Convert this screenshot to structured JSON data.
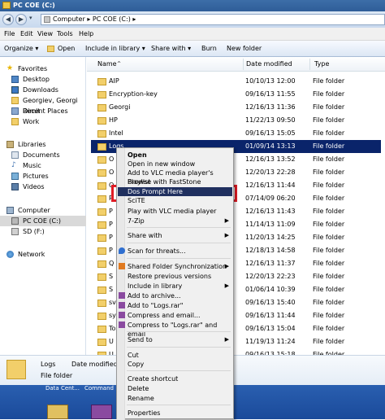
{
  "window": {
    "title": "PC COE (C:)"
  },
  "address": {
    "path": "Computer ▸ PC COE (C:) ▸"
  },
  "menubar": [
    "File",
    "Edit",
    "View",
    "Tools",
    "Help"
  ],
  "toolbar": [
    "Organize ▾",
    "Open",
    "Include in library ▾",
    "Share with ▾",
    "Burn",
    "New folder"
  ],
  "nav": {
    "favorites": {
      "header": "Favorites",
      "items": [
        "Desktop",
        "Downloads",
        "Georgiev, Georgi Dimit",
        "Recent Places",
        "Work"
      ]
    },
    "libraries": {
      "header": "Libraries",
      "items": [
        "Documents",
        "Music",
        "Pictures",
        "Videos"
      ]
    },
    "computer": {
      "header": "Computer",
      "items": [
        "PC COE (C:)",
        "SD (F:)"
      ]
    },
    "network": "Network"
  },
  "columns": {
    "name": "Name",
    "date": "Date modified",
    "type": "Type"
  },
  "files": [
    {
      "name": "AIP",
      "date": "10/10/13 12:00",
      "type": "File folder"
    },
    {
      "name": "Encryption-key",
      "date": "09/16/13 11:55",
      "type": "File folder"
    },
    {
      "name": "Georgi",
      "date": "12/16/13 11:36",
      "type": "File folder"
    },
    {
      "name": "HP",
      "date": "11/22/13 09:50",
      "type": "File folder"
    },
    {
      "name": "Intel",
      "date": "09/16/13 15:05",
      "type": "File folder"
    },
    {
      "name": "Logs",
      "date": "01/09/14 13:13",
      "type": "File folder"
    },
    {
      "name": "O",
      "date": "12/16/13 13:52",
      "type": "File folder"
    },
    {
      "name": "O",
      "date": "12/20/13 22:28",
      "type": "File folder"
    },
    {
      "name": "O",
      "date": "12/16/13 11:44",
      "type": "File folder"
    },
    {
      "name": "P",
      "date": "07/14/09 06:20",
      "type": "File folder"
    },
    {
      "name": "P",
      "date": "12/16/13 11:43",
      "type": "File folder"
    },
    {
      "name": "P",
      "date": "11/14/13 11:09",
      "type": "File folder"
    },
    {
      "name": "P",
      "date": "11/20/13 14:25",
      "type": "File folder"
    },
    {
      "name": "P",
      "date": "12/18/13 14:58",
      "type": "File folder"
    },
    {
      "name": "Q",
      "date": "12/16/13 11:37",
      "type": "File folder"
    },
    {
      "name": "S",
      "date": "12/20/13 22:23",
      "type": "File folder"
    },
    {
      "name": "S",
      "date": "01/06/14 10:39",
      "type": "File folder"
    },
    {
      "name": "sv",
      "date": "09/16/13 15:40",
      "type": "File folder"
    },
    {
      "name": "sy",
      "date": "09/16/13 11:44",
      "type": "File folder"
    },
    {
      "name": "To",
      "date": "09/16/13 15:04",
      "type": "File folder"
    },
    {
      "name": "U",
      "date": "11/19/13 11:24",
      "type": "File folder"
    },
    {
      "name": "U",
      "date": "09/16/13 15:18",
      "type": "File folder"
    }
  ],
  "details": {
    "name": "Logs",
    "date_label": "Date modified: 01/09/14 13:13",
    "type": "File folder"
  },
  "taskbar": [
    "Data Cent...",
    "Command"
  ],
  "context_menu": [
    {
      "label": "Open",
      "bold": true
    },
    {
      "label": "Open in new window"
    },
    {
      "label": "Add to VLC media player's Playlist"
    },
    {
      "label": "Browse with FastStone"
    },
    {
      "label": "Dos Prompt Here",
      "highlighted": true
    },
    {
      "label": "SciTE"
    },
    {
      "label": "Play with VLC media player"
    },
    {
      "label": "7-Zip",
      "submenu": true
    },
    {
      "label": "Share with",
      "submenu": true
    },
    {
      "label": "Scan for threats..."
    },
    {
      "label": "Shared Folder Synchronization",
      "submenu": true
    },
    {
      "label": "Restore previous versions"
    },
    {
      "label": "Include in library",
      "submenu": true
    },
    {
      "label": "Add to archive..."
    },
    {
      "label": "Add to \"Logs.rar\""
    },
    {
      "label": "Compress and email..."
    },
    {
      "label": "Compress to \"Logs.rar\" and email"
    },
    {
      "label": "Send to",
      "submenu": true
    },
    {
      "label": "Cut"
    },
    {
      "label": "Copy"
    },
    {
      "label": "Create shortcut"
    },
    {
      "label": "Delete"
    },
    {
      "label": "Rename"
    },
    {
      "label": "Properties"
    }
  ],
  "colors": {
    "selection": "#0a246a",
    "menu_highlight": "#20305f",
    "red_outline": "#e01b24",
    "folder": "#f2cf6a"
  }
}
